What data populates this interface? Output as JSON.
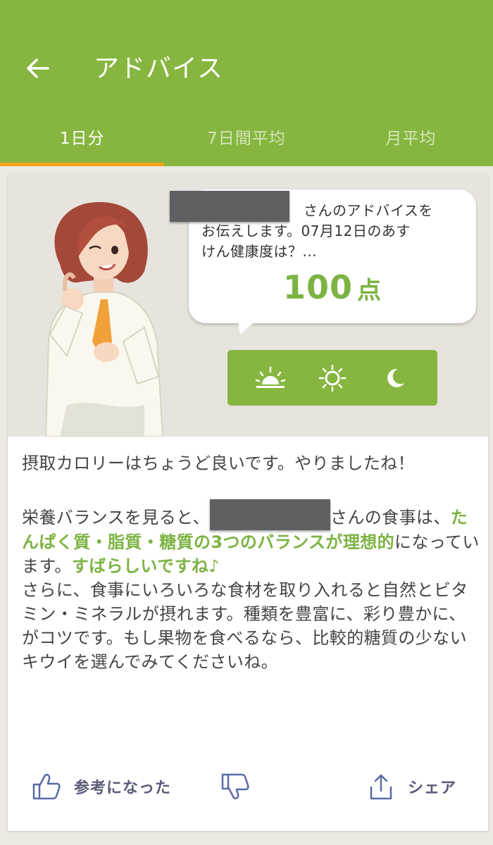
{
  "header": {
    "title": "アドバイス"
  },
  "tabs": [
    {
      "label": "1日分",
      "active": true
    },
    {
      "label": "7日間平均",
      "active": false
    },
    {
      "label": "月平均",
      "active": false
    }
  ],
  "bubble": {
    "line1_suffix": "さんのアドバイスを",
    "line2": "お伝えします。07月12日のあす",
    "line3": "けん健康度は？...",
    "score_value": "100",
    "score_unit": "点"
  },
  "meals": [
    {
      "icon": "sunrise-icon",
      "name": "breakfast"
    },
    {
      "icon": "sun-icon",
      "name": "lunch"
    },
    {
      "icon": "moon-icon",
      "name": "dinner"
    }
  ],
  "advice": {
    "p1": "摂取カロリーはちょうど良いです。やりましたね！",
    "p2_a": "栄養バランスを見ると、",
    "p2_b": "さんの食事は、",
    "p2_hl1": "たんぱく質・脂質・糖質の3つのバランスが理想的",
    "p2_c": "になっています。",
    "p2_hl2": "すばらしいですね♪",
    "p2_d": "さらに、食事にいろいろな食材を取り入れると自然とビタミン・ミネラルが摂れます。種類を豊富に、彩り豊かに、がコツです。もし果物を食べるなら、比較的糖質の少ないキウイを選んでみてくださいね。"
  },
  "actions": {
    "helpful_label": "参考になった",
    "share_label": "シェア"
  },
  "colors": {
    "primary": "#86b63f",
    "accent": "#f2a31a",
    "highlight": "#7cb342"
  }
}
